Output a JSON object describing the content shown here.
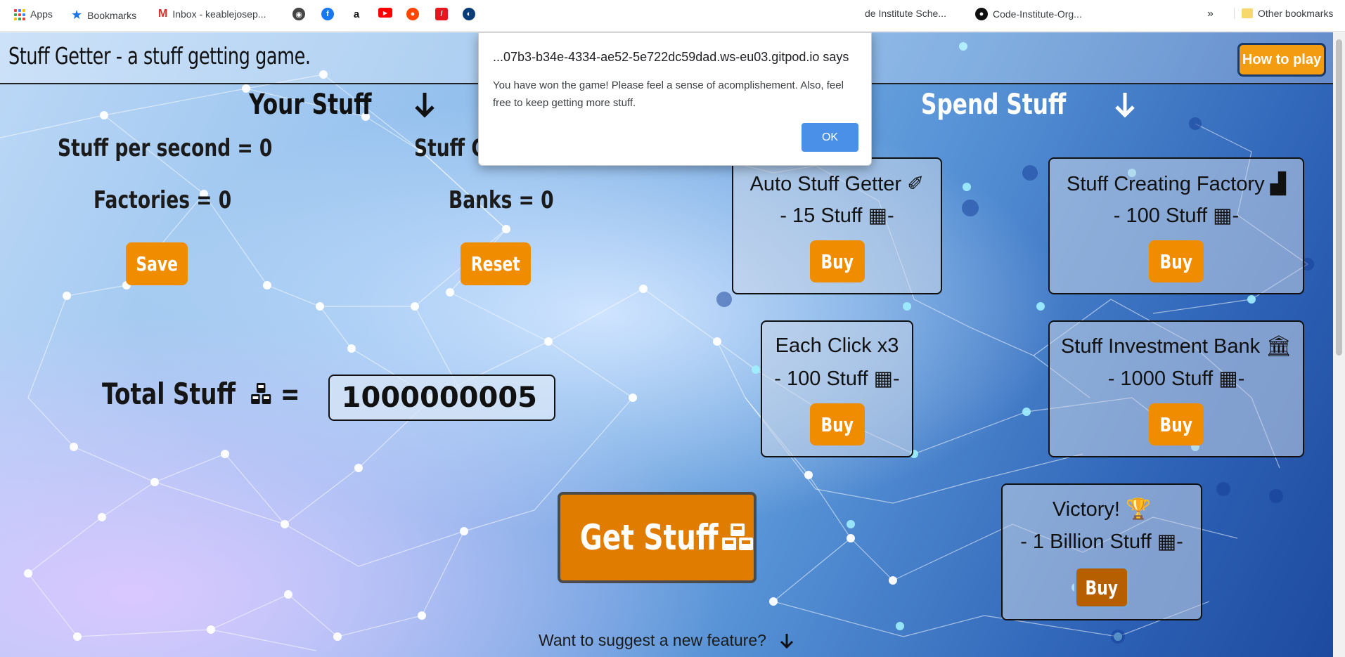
{
  "browser": {
    "bookmarks": [
      {
        "label": "Apps",
        "icon": "apps-grid-icon"
      },
      {
        "label": "Bookmarks",
        "icon": "star-icon"
      },
      {
        "label": "Inbox - keablejosep...",
        "icon": "gmail-icon"
      },
      {
        "label": "",
        "icon": "site-icon-1"
      },
      {
        "label": "",
        "icon": "facebook-icon"
      },
      {
        "label": "",
        "icon": "amazon-icon"
      },
      {
        "label": "",
        "icon": "youtube-icon"
      },
      {
        "label": "",
        "icon": "reddit-icon"
      },
      {
        "label": "",
        "icon": "red-site-icon"
      },
      {
        "label": "",
        "icon": "github-dark-icon"
      },
      {
        "label": "de Institute Sche...",
        "icon": "none"
      },
      {
        "label": "Code-Institute-Org...",
        "icon": "github-icon"
      }
    ],
    "overflow": "»",
    "other_bookmarks": "Other bookmarks"
  },
  "dialog": {
    "title": "...07b3-b34e-4334-ae52-5e722dc59dad.ws-eu03.gitpod.io says",
    "message": "You have won the game! Please feel a sense of acomplishement. Also, feel free to keep getting more stuff.",
    "ok_label": "OK"
  },
  "header": {
    "title": "Stuff Getter - a stuff getting game.",
    "how_to_play": "How to play"
  },
  "your_stuff": {
    "heading": "Your Stuff",
    "stuff_per_second": "Stuff per second = 0",
    "stuff_getters": "Stuff Getters = 0",
    "factories": "Factories = 0",
    "banks": "Banks = 0",
    "save_label": "Save",
    "reset_label": "Reset",
    "total_label": "Total Stuff",
    "total_equals": "=",
    "total_value": "1000000005"
  },
  "get_stuff_label": "Get Stuff",
  "spend_stuff": {
    "heading": "Spend Stuff",
    "items": [
      {
        "title": "Auto Stuff Getter",
        "cost": "- 15 Stuff",
        "icon": "magic-wand-icon",
        "buy": "Buy"
      },
      {
        "title": "Stuff Creating Factory",
        "cost": "- 100 Stuff",
        "icon": "factory-icon",
        "buy": "Buy"
      },
      {
        "title": "Each Click x3",
        "cost": "- 100 Stuff",
        "icon": "",
        "buy": "Buy"
      },
      {
        "title": "Stuff Investment Bank",
        "cost": "- 1000 Stuff",
        "icon": "bank-icon",
        "buy": "Buy"
      },
      {
        "title": "Victory!",
        "cost": "- 1 Billion Stuff",
        "icon": "trophy-icon",
        "buy": "Buy"
      }
    ],
    "cost_suffix": "-"
  },
  "suggest_label": "Want to suggest a new feature?",
  "colors": {
    "button_orange": "#f08c00",
    "get_stuff_orange": "#e07c00",
    "dialog_ok_blue": "#4a90e8"
  }
}
